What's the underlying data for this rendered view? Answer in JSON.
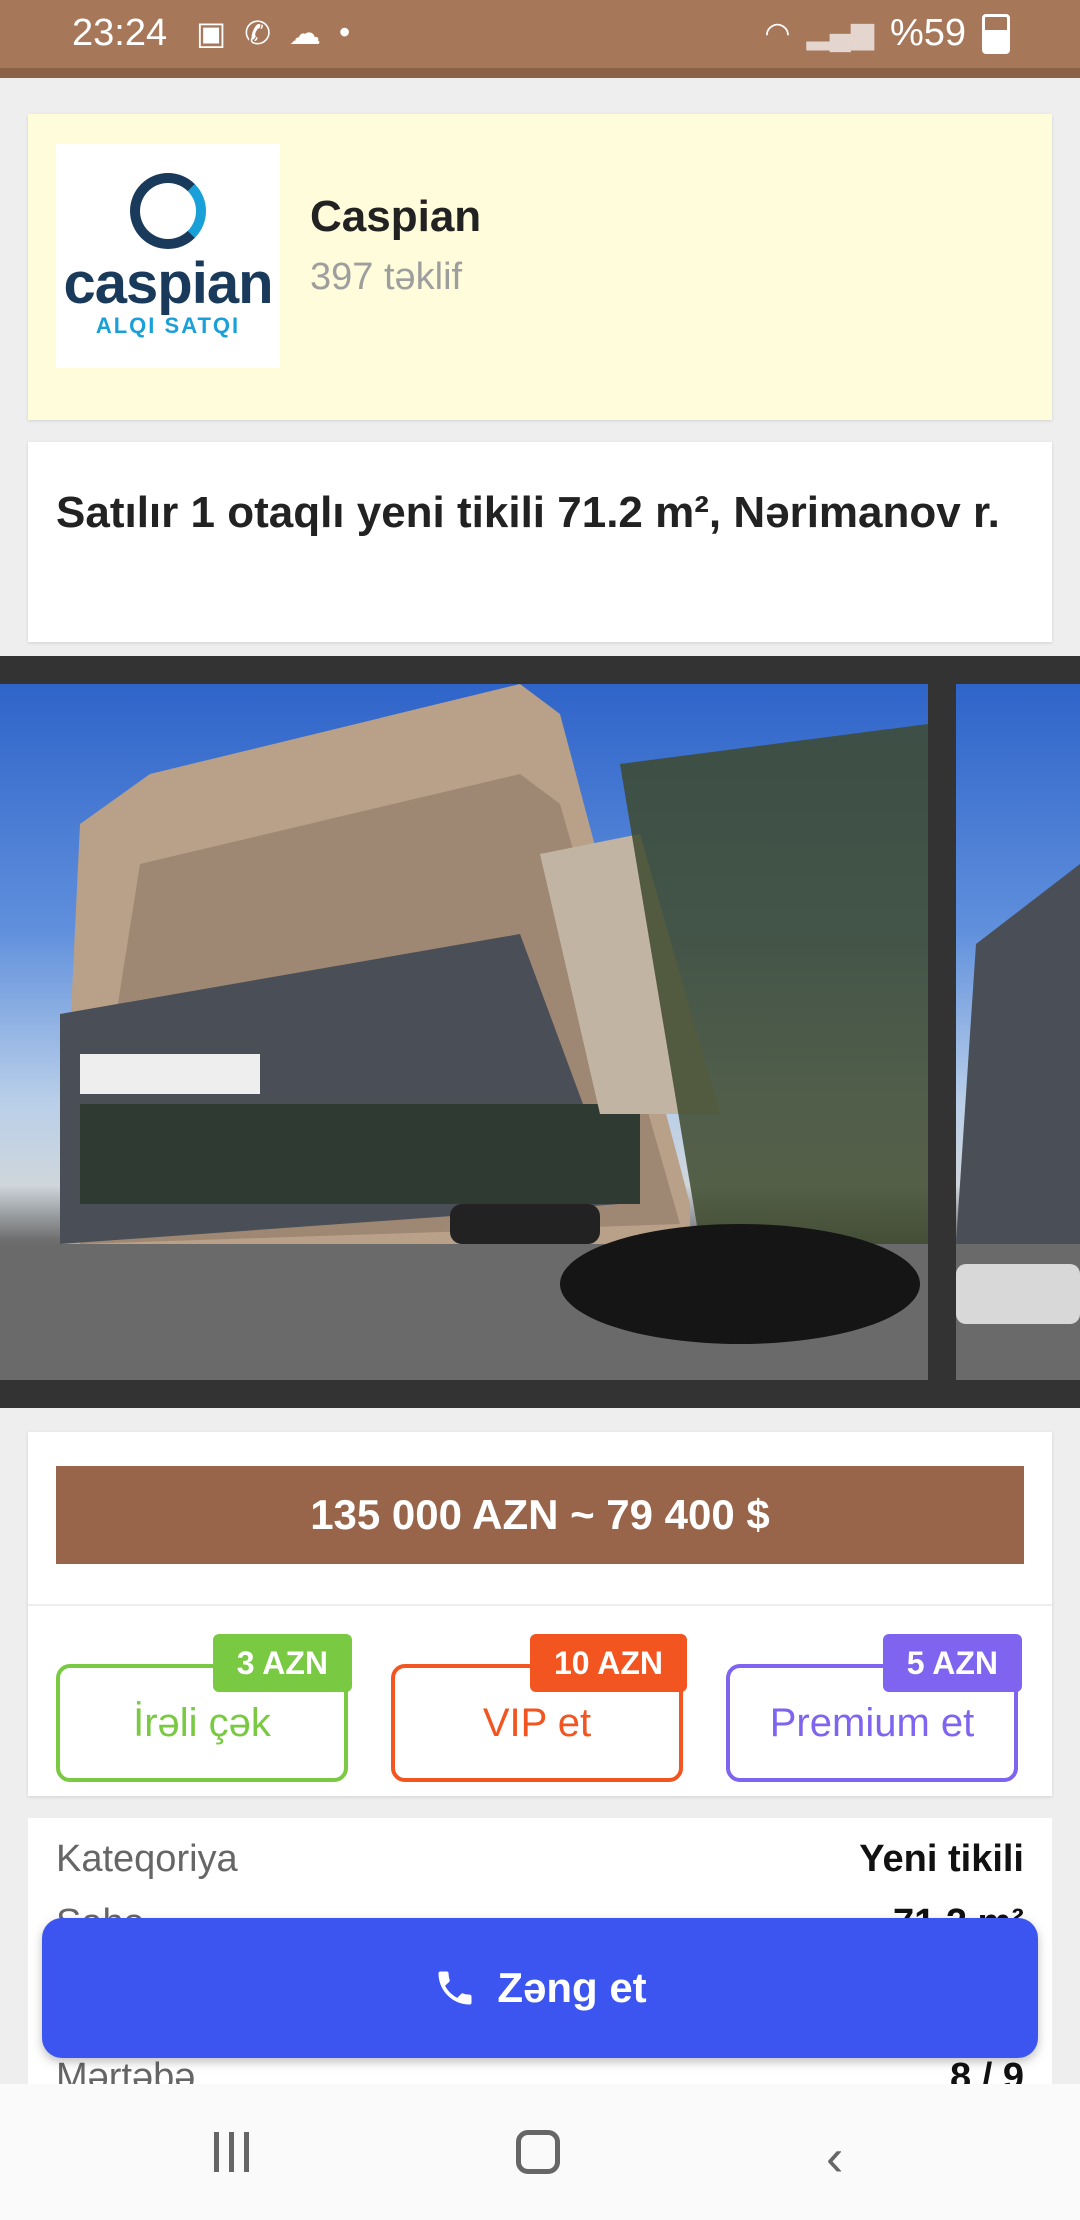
{
  "status_bar": {
    "time": "23:24",
    "battery": "%59",
    "left_icons": [
      "image-icon",
      "whatsapp-icon",
      "cloud-icon",
      "dot-icon"
    ],
    "right_icons": [
      "wifi-icon",
      "signal-icon",
      "battery-icon"
    ]
  },
  "seller": {
    "logo_word": "caspian",
    "logo_sub": "ALQI SATQI",
    "name": "Caspian",
    "offers": "397 təklif"
  },
  "listing": {
    "title": "Satılır 1 otaqlı yeni tikili 71.2 m², Nərimanov r."
  },
  "price": {
    "text": "135 000 AZN ~ 79 400 $"
  },
  "promotions": [
    {
      "label": "İrəli çək",
      "badge": "3 AZN",
      "color": "#7ac943"
    },
    {
      "label": "VIP et",
      "badge": "10 AZN",
      "color": "#f2551f"
    },
    {
      "label": "Premium et",
      "badge": "5 AZN",
      "color": "#7f64f0"
    }
  ],
  "details": [
    {
      "key": "Kateqoriya",
      "value": "Yeni tikili"
    },
    {
      "key": "Sahə",
      "value": "71.2 m²"
    },
    {
      "key": "Mərtəbə",
      "value": "8 / 9"
    }
  ],
  "call_button": {
    "label": "Zəng et",
    "color": "#3c55f0"
  },
  "accent_color": "#98644a"
}
